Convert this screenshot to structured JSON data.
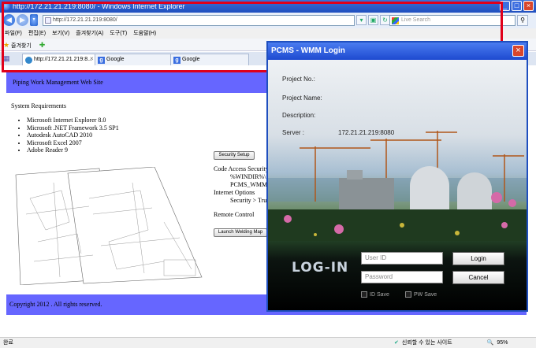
{
  "window": {
    "title": "http://172.21.21.219:8080/ - Windows Internet Explorer",
    "min": "_",
    "max": "□",
    "close": "×"
  },
  "nav": {
    "back": "◀",
    "forward": "▶",
    "address": "http://172.21.21.219:8080/",
    "refresh": "↻",
    "stop": "×",
    "search_placeholder": "Live Search",
    "search_go": "⚲"
  },
  "menu": [
    "파일(F)",
    "편집(E)",
    "보기(V)",
    "즐겨찾기(A)",
    "도구(T)",
    "도움말(H)"
  ],
  "favorites": {
    "label": "즐겨찾기"
  },
  "tabs": [
    {
      "label": "http://172.21.21.219:8..."
    },
    {
      "label": "Google"
    },
    {
      "label": "Google"
    }
  ],
  "page": {
    "header": "Piping Work Management Web Site",
    "sysreq_title": "System Requirements",
    "requirements": [
      "Microsoft Internet Explorer 8.0",
      "Microsoft .NET Framework 3.5 SP1",
      "Autodesk AutoCAD 2010",
      "Microsoft Excel 2007",
      "Adobe Reader 9"
    ],
    "security_setup": "Security Setup",
    "code_access": "Code Access Security",
    "windir": "%WINDIR%\\",
    "pcms_wmm": "PCMS_WMM",
    "internet_options": "Internet Options",
    "security_trust": "Security > Trus",
    "remote_control": "Remote Control",
    "launch_welding": "Launch Welding Map",
    "footer": "Copyright 2012 . All rights reserved."
  },
  "status": {
    "left": "완료",
    "zone": "신뢰할 수 있는 사이트",
    "zoom": "95%"
  },
  "dialog": {
    "title": "PCMS - WMM Login",
    "close": "×",
    "project_no": "Project No.:",
    "project_name": "Project Name:",
    "description": "Description:",
    "server_label": "Server :",
    "server_value": "172.21.21.219:8080",
    "logo": "LOG-IN",
    "user_placeholder": "User ID",
    "password_placeholder": "Password",
    "login": "Login",
    "cancel": "Cancel",
    "id_save": "ID Save",
    "pw_save": "PW Save"
  }
}
